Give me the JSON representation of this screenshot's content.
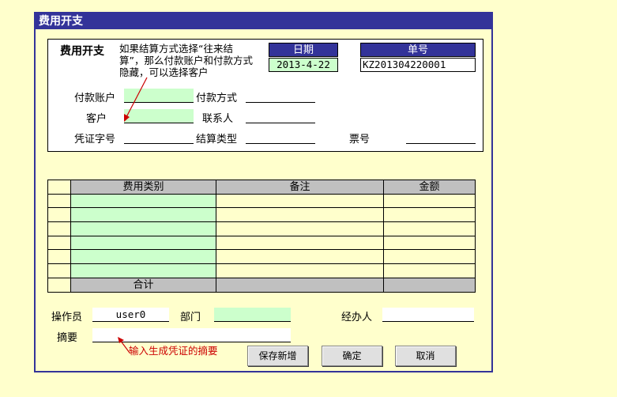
{
  "window": {
    "title": "费用开支"
  },
  "header": {
    "panel_title": "费用开支",
    "tip": "如果结算方式选择“往来结算”，那么付款账户和付款方式隐藏，可以选择客户",
    "date_label": "日期",
    "date_value": "2013-4-22",
    "number_label": "单号",
    "number_value": "KZ201304220001",
    "pay_account_label": "付款账户",
    "pay_method_label": "付款方式",
    "customer_label": "客户",
    "contact_label": "联系人",
    "voucher_label": "凭证字号",
    "settle_type_label": "结算类型",
    "ticket_label": "票号"
  },
  "table": {
    "columns": [
      "费用类别",
      "备注",
      "金额"
    ],
    "row_count": 6,
    "total_label": "合计"
  },
  "footer": {
    "operator_label": "操作员",
    "operator_value": "user0",
    "dept_label": "部门",
    "handler_label": "经办人",
    "summary_label": "摘要",
    "summary_tip": "输入生成凭证的摘要"
  },
  "buttons": {
    "save_new": "保存新增",
    "ok": "确定",
    "cancel": "取消"
  },
  "colors": {
    "title_bar": "#333399",
    "background": "#FFFFCC",
    "editable": "#CCFFCC",
    "tip_text": "#CC0000"
  }
}
